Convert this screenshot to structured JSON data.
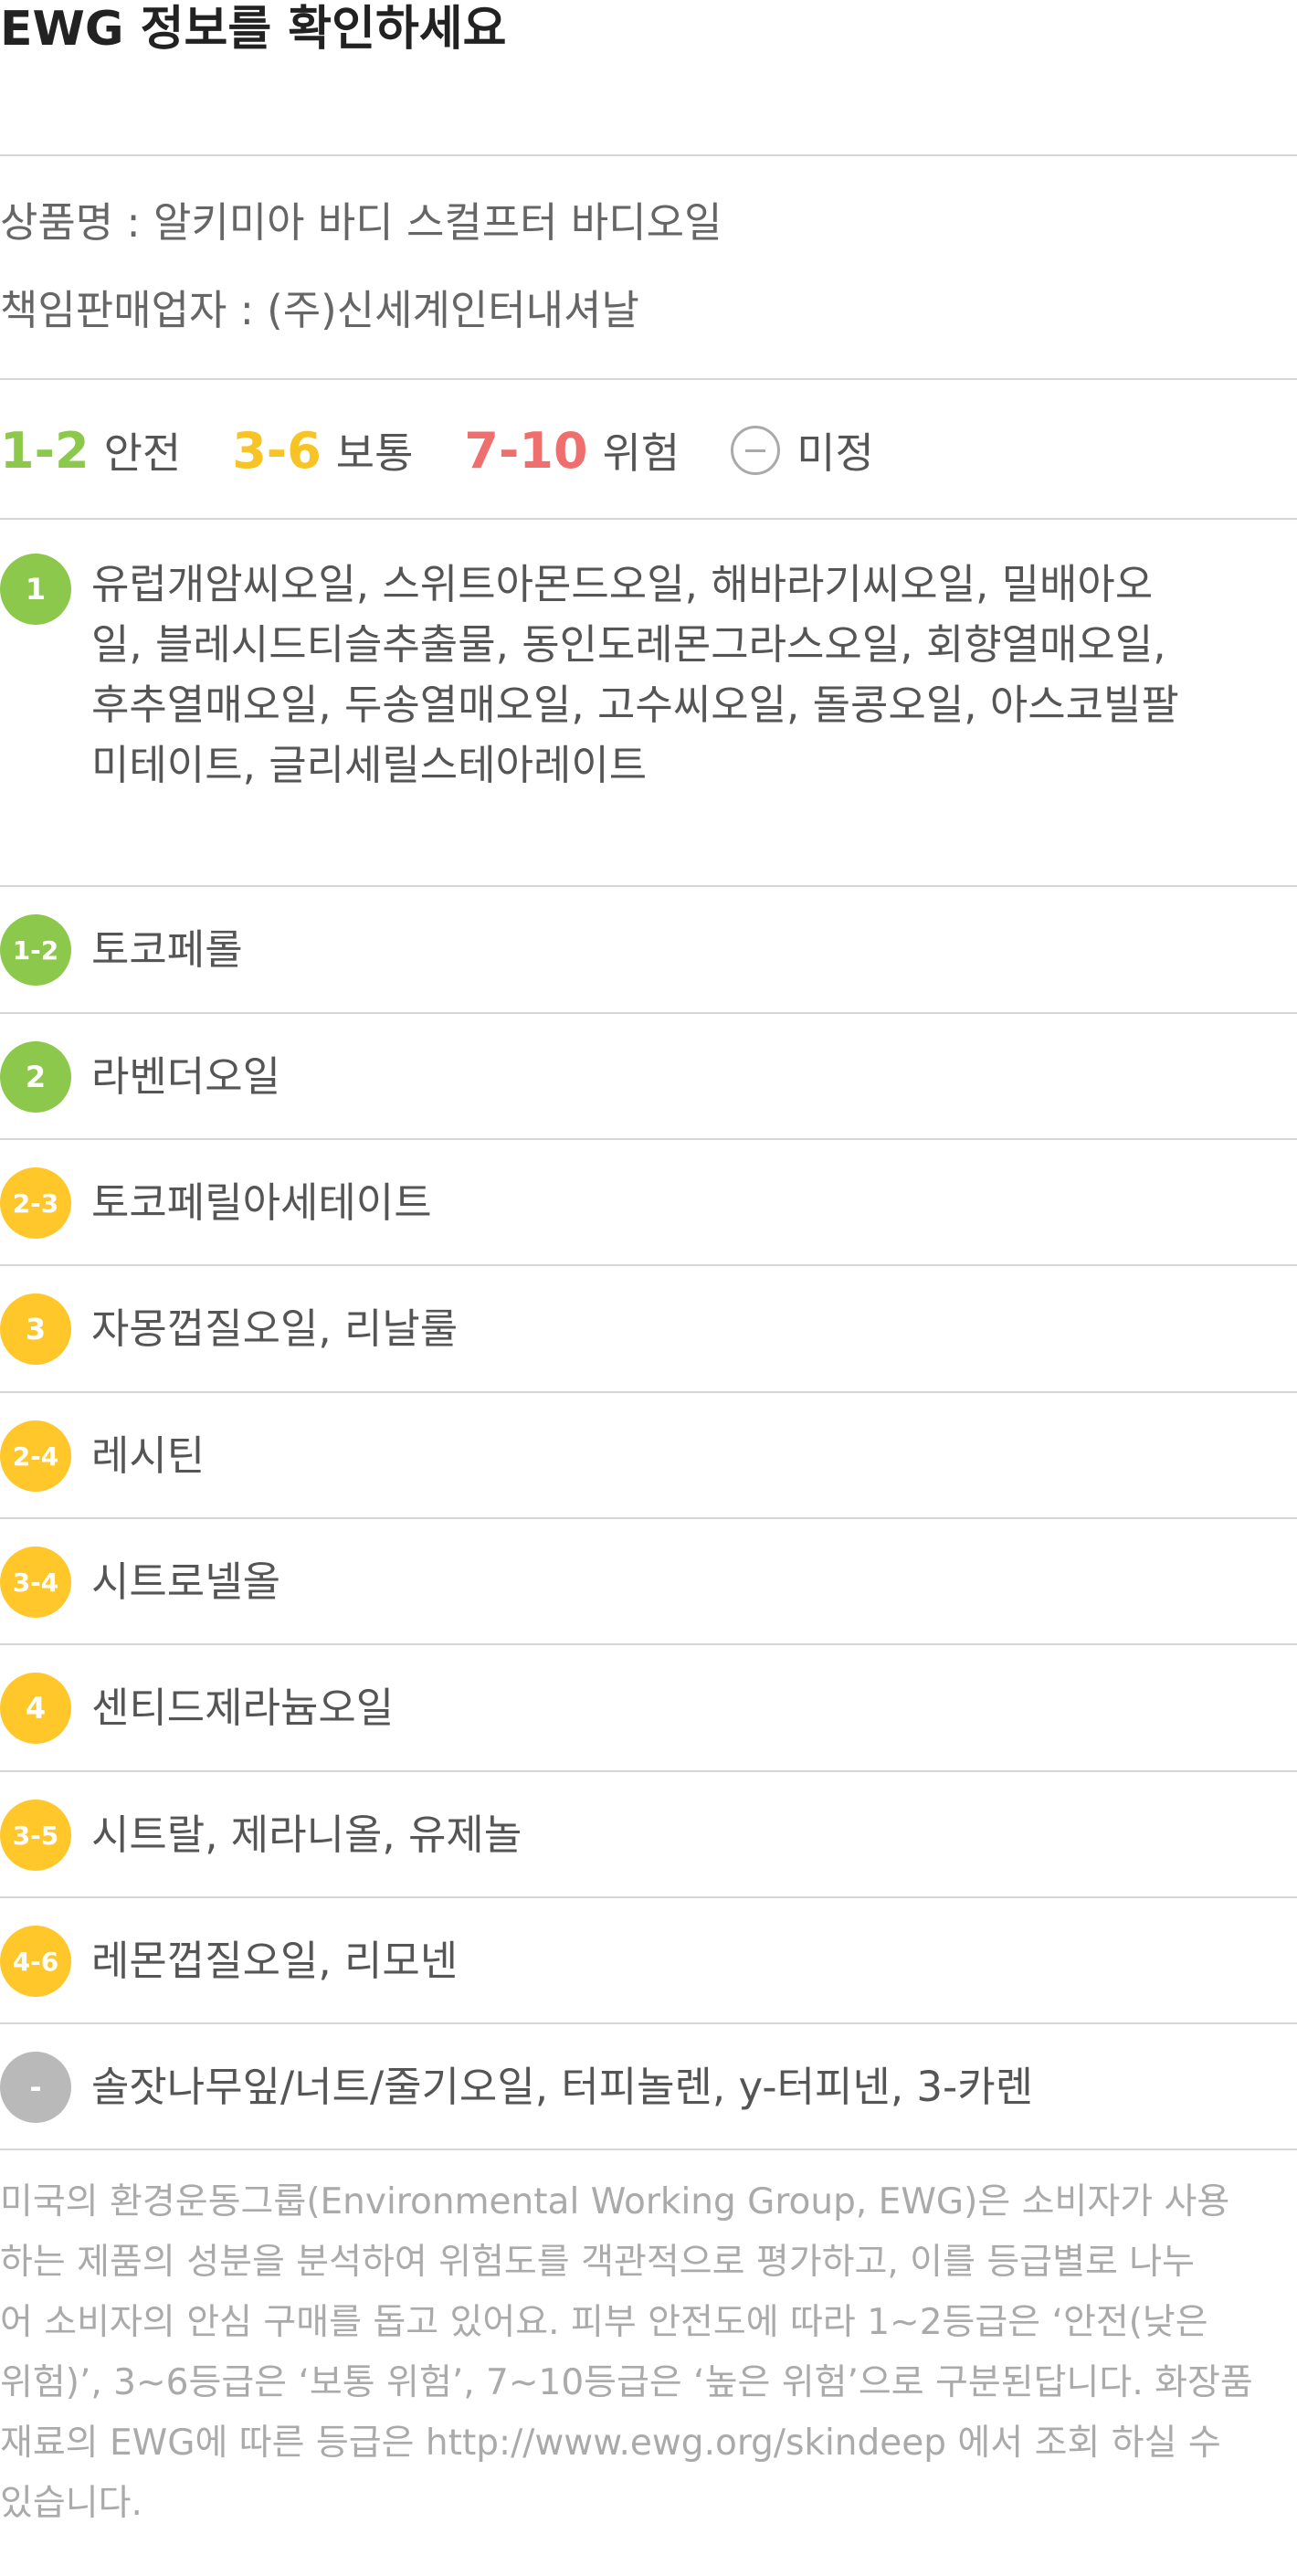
{
  "header": {
    "title": "EWG 정보를 확인하세요"
  },
  "product": {
    "name_line": "상품명 : 알키미아 바디 스컬프터 바디오일",
    "seller_line": "책임판매업자 : (주)신세계인터내셔날"
  },
  "legend": [
    {
      "range": "1-2",
      "label": "안전",
      "color": "#8cc84b"
    },
    {
      "range": "3-6",
      "label": "보통",
      "color": "#f7c325"
    },
    {
      "range": "7-10",
      "label": "위험",
      "color": "#ef6e6e"
    },
    {
      "icon": "minus-circle-icon",
      "label": "미정",
      "color": "#aaaaaa"
    }
  ],
  "ingredients": [
    {
      "grade": "1",
      "color": "green",
      "lines": [
        "유럽개암씨오일, 스위트아몬드오일, 해바라기씨오일, 밀배아오",
        "일, 블레시드티슬추출물, 동인도레몬그라스오일, 회향열매오일,",
        "후추열매오일, 두송열매오일, 고수씨오일, 돌콩오일, 아스코빌팔",
        "미테이트, 글리세릴스테아레이트"
      ]
    },
    {
      "grade": "1-2",
      "color": "green",
      "lines": [
        "토코페롤"
      ]
    },
    {
      "grade": "2",
      "color": "green",
      "lines": [
        "라벤더오일"
      ]
    },
    {
      "grade": "2-3",
      "color": "yellow",
      "lines": [
        "토코페릴아세테이트"
      ]
    },
    {
      "grade": "3",
      "color": "yellow",
      "lines": [
        "자몽껍질오일, 리날룰"
      ]
    },
    {
      "grade": "2-4",
      "color": "yellow",
      "lines": [
        "레시틴"
      ]
    },
    {
      "grade": "3-4",
      "color": "yellow",
      "lines": [
        "시트로넬올"
      ]
    },
    {
      "grade": "4",
      "color": "yellow",
      "lines": [
        "센티드제라늄오일"
      ]
    },
    {
      "grade": "3-5",
      "color": "yellow",
      "lines": [
        "시트랄, 제라니올, 유제놀"
      ]
    },
    {
      "grade": "4-6",
      "color": "yellow",
      "lines": [
        "레몬껍질오일, 리모넨"
      ]
    },
    {
      "grade": "-",
      "color": "grey",
      "lines": [
        "솔잣나무잎/너트/줄기오일, 터피놀렌, y-터피넨, 3-카렌"
      ]
    }
  ],
  "footer": {
    "lines": [
      "미국의 환경운동그룹(Environmental Working Group, EWG)은 소비자가 사용",
      "하는 제품의 성분을 분석하여 위험도를 객관적으로 평가하고, 이를 등급별로 나누",
      "어 소비자의 안심 구매를 돕고 있어요. 피부 안전도에 따라 1~2등급은 ‘안전(낮은",
      "위험)’, 3~6등급은 ‘보통 위험’, 7~10등급은 ‘높은 위험’으로 구분된답니다. 화장품",
      "재료의 EWG에 따른 등급은 http://www.ewg.org/skindeep 에서 조회 하실 수",
      "있습니다."
    ]
  }
}
